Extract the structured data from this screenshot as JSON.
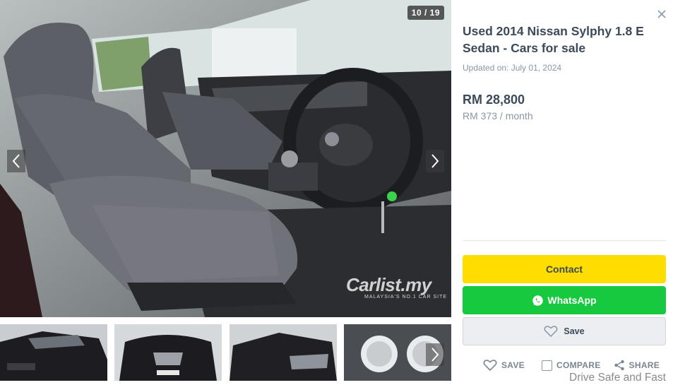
{
  "gallery": {
    "counter": "10 / 19",
    "watermark_brand": "Carlist.my",
    "watermark_tag": "MALAYSIA'S NO.1 CAR SITE",
    "main_image": "car-interior-front-seats",
    "thumbnails": [
      "car-front-three-quarter",
      "car-front-grille",
      "car-front-angle",
      "car-instrument-cluster"
    ]
  },
  "listing": {
    "title": "Used 2014 Nissan Sylphy 1.8 E Sedan - Cars for sale",
    "updated": "Updated on: July 01, 2024",
    "price": "RM 28,800",
    "monthly": "RM 373 / month"
  },
  "buttons": {
    "contact": "Contact",
    "whatsapp": "WhatsApp",
    "save": "Save"
  },
  "actions": {
    "save": "SAVE",
    "compare": "COMPARE",
    "share": "SHARE"
  },
  "footer": {
    "tagline": "Drive Safe and Fast"
  },
  "icons": {
    "close": "close-icon",
    "prev": "chevron-left-icon",
    "next": "chevron-right-icon",
    "whatsapp": "whatsapp-icon",
    "heart": "heart-icon",
    "share": "share-icon"
  },
  "colors": {
    "contact_button": "#ffdd00",
    "whatsapp_button": "#17c93f",
    "title_text": "#3c4a5a",
    "muted_text": "#8a96a3"
  }
}
